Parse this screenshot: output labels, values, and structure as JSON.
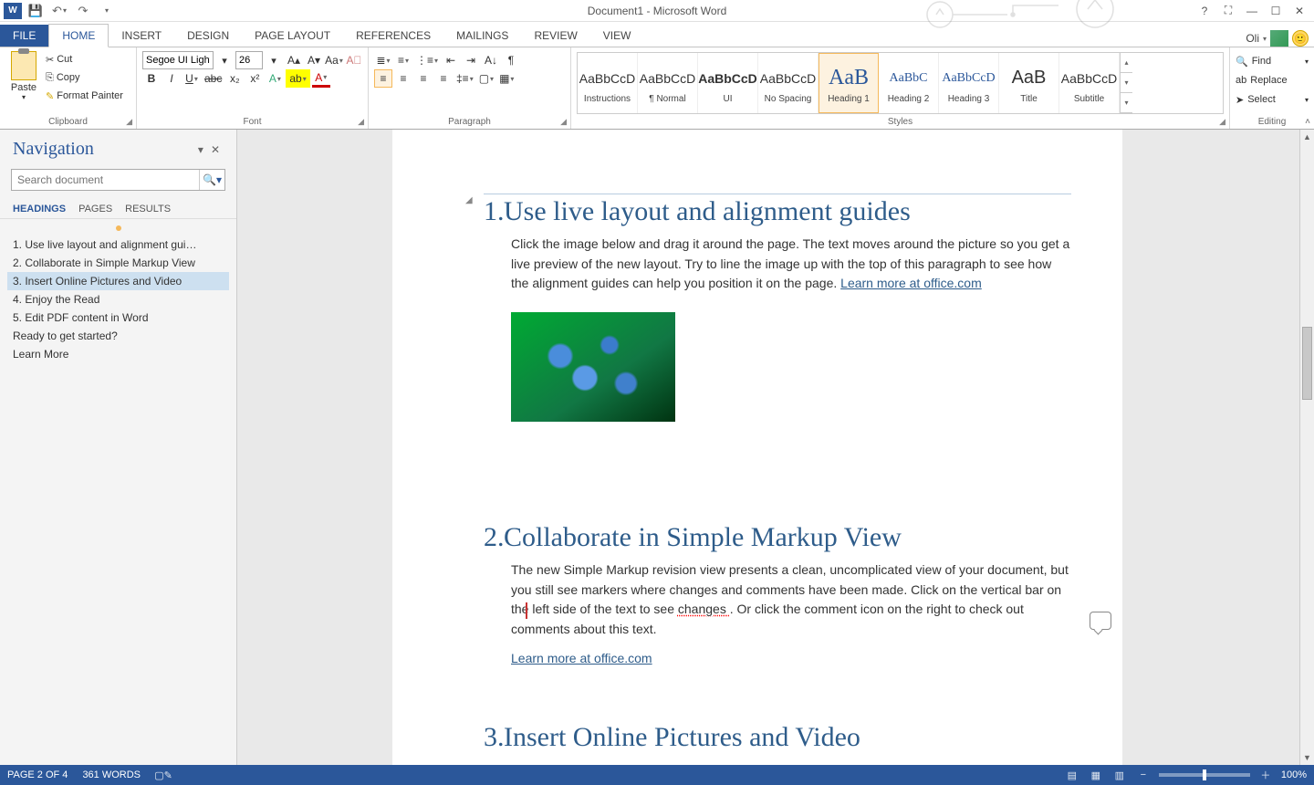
{
  "titlebar": {
    "title": "Document1 - Microsoft Word",
    "user": "Oli"
  },
  "tabs": {
    "file": "FILE",
    "home": "HOME",
    "insert": "INSERT",
    "design": "DESIGN",
    "page_layout": "PAGE LAYOUT",
    "references": "REFERENCES",
    "mailings": "MAILINGS",
    "review": "REVIEW",
    "view": "VIEW"
  },
  "ribbon": {
    "clipboard": {
      "label": "Clipboard",
      "paste": "Paste",
      "cut": "Cut",
      "copy": "Copy",
      "format_painter": "Format Painter"
    },
    "font": {
      "label": "Font",
      "name": "Segoe UI Light",
      "size": "26"
    },
    "paragraph": {
      "label": "Paragraph"
    },
    "styles": {
      "label": "Styles",
      "items": [
        {
          "preview": "AaBbCcD",
          "name": "Instructions",
          "head": false
        },
        {
          "preview": "AaBbCcD",
          "name": "¶ Normal",
          "head": false
        },
        {
          "preview": "AaBbCcD",
          "name": "UI",
          "head": false,
          "bold": true
        },
        {
          "preview": "AaBbCcD",
          "name": "No Spacing",
          "head": false
        },
        {
          "preview": "AaB",
          "name": "Heading 1",
          "head": true,
          "sel": true
        },
        {
          "preview": "AaBbC",
          "name": "Heading 2",
          "head": true
        },
        {
          "preview": "AaBbCcD",
          "name": "Heading 3",
          "head": true
        },
        {
          "preview": "AaB",
          "name": "Title",
          "head": false
        },
        {
          "preview": "AaBbCcD",
          "name": "Subtitle",
          "head": false
        }
      ]
    },
    "editing": {
      "label": "Editing",
      "find": "Find",
      "replace": "Replace",
      "select": "Select"
    }
  },
  "nav": {
    "title": "Navigation",
    "search_placeholder": "Search document",
    "tabs": {
      "headings": "HEADINGS",
      "pages": "PAGES",
      "results": "RESULTS"
    },
    "items": [
      "1. Use live layout and alignment gui…",
      "2. Collaborate in Simple Markup View",
      "3. Insert Online Pictures and Video",
      "4. Enjoy the Read",
      "5. Edit PDF content in Word",
      "Ready to get started?",
      "Learn More"
    ],
    "selected": 2
  },
  "doc": {
    "h1": {
      "num": "1.",
      "title": "Use live layout and alignment guides",
      "body": "Click the image below and drag it around the page. The text moves around the picture so you get a live preview of the new layout. Try to line the image up with the top of this paragraph to see how the alignment guides can help you position it on the page. ",
      "link": "Learn more at office.com"
    },
    "h2": {
      "num": "2.",
      "title": "Collaborate in Simple Markup View",
      "body1": "The new Simple Markup revision view presents a clean, uncomplicated view of your document, but you still see markers where changes and comments have been made. Click on the vertical bar on the left side of the text to see ",
      "change_word": "changes ",
      "body2": ". Or click the comment icon on the right to check out comments about this text.",
      "link": "Learn more at office.com"
    },
    "h3": {
      "num": "3.",
      "title": "Insert Online Pictures and Video"
    }
  },
  "status": {
    "page": "PAGE 2 OF 4",
    "words": "361 WORDS",
    "zoom": "100%"
  }
}
